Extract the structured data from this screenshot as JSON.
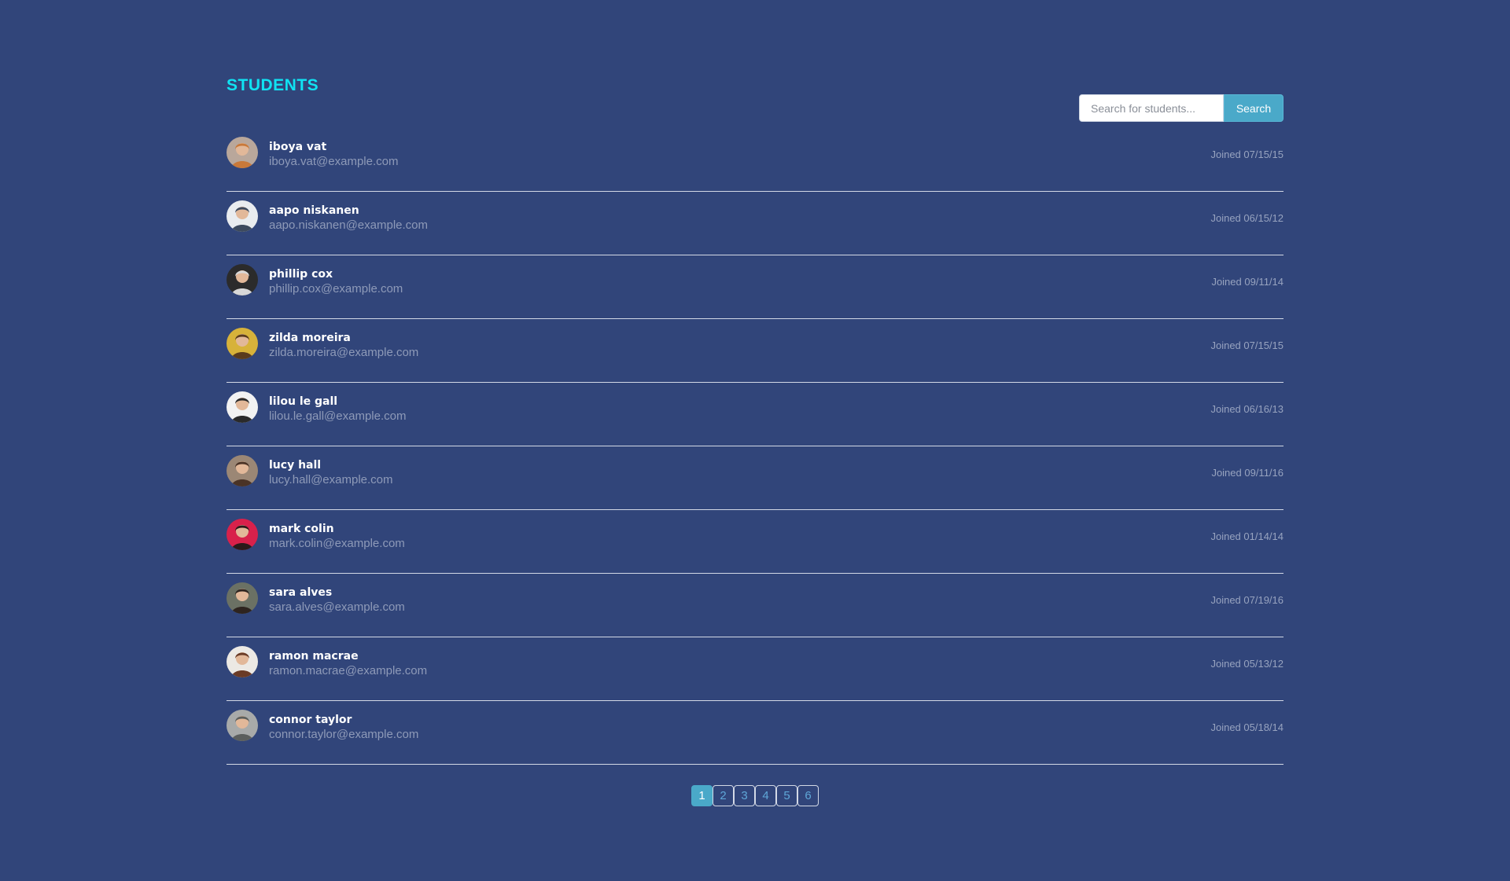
{
  "header": {
    "title": "STUDENTS"
  },
  "search": {
    "placeholder": "Search for students...",
    "value": "",
    "button_label": "Search"
  },
  "students": [
    {
      "name": "iboya vat",
      "email": "iboya.vat@example.com",
      "joined": "Joined 07/15/15",
      "avatar_bg": "#b9a79b",
      "avatar_fg": "#c9793a"
    },
    {
      "name": "aapo niskanen",
      "email": "aapo.niskanen@example.com",
      "joined": "Joined 06/15/12",
      "avatar_bg": "#e9ecef",
      "avatar_fg": "#3d4a5e"
    },
    {
      "name": "phillip cox",
      "email": "phillip.cox@example.com",
      "joined": "Joined 09/11/14",
      "avatar_bg": "#2b2b2b",
      "avatar_fg": "#d8d8d8"
    },
    {
      "name": "zilda moreira",
      "email": "zilda.moreira@example.com",
      "joined": "Joined 07/15/15",
      "avatar_bg": "#d7b23a",
      "avatar_fg": "#5a3b1d"
    },
    {
      "name": "lilou le gall",
      "email": "lilou.le.gall@example.com",
      "joined": "Joined 06/16/13",
      "avatar_bg": "#f2f2f2",
      "avatar_fg": "#2a2a2a"
    },
    {
      "name": "lucy hall",
      "email": "lucy.hall@example.com",
      "joined": "Joined 09/11/16",
      "avatar_bg": "#9b8775",
      "avatar_fg": "#4a3326"
    },
    {
      "name": "mark colin",
      "email": "mark.colin@example.com",
      "joined": "Joined 01/14/14",
      "avatar_bg": "#d8214b",
      "avatar_fg": "#2b1a1a"
    },
    {
      "name": "sara alves",
      "email": "sara.alves@example.com",
      "joined": "Joined 07/19/16",
      "avatar_bg": "#6b7164",
      "avatar_fg": "#2e241f"
    },
    {
      "name": "ramon macrae",
      "email": "ramon.macrae@example.com",
      "joined": "Joined 05/13/12",
      "avatar_bg": "#ece9e4",
      "avatar_fg": "#6a3b26"
    },
    {
      "name": "connor taylor",
      "email": "connor.taylor@example.com",
      "joined": "Joined 05/18/14",
      "avatar_bg": "#a8aaa9",
      "avatar_fg": "#5c5f5d"
    }
  ],
  "pagination": {
    "pages": [
      "1",
      "2",
      "3",
      "4",
      "5",
      "6"
    ],
    "current": "1"
  },
  "colors": {
    "background": "#31457a",
    "title": "#10e2f2",
    "accent": "#4aa9c9"
  }
}
